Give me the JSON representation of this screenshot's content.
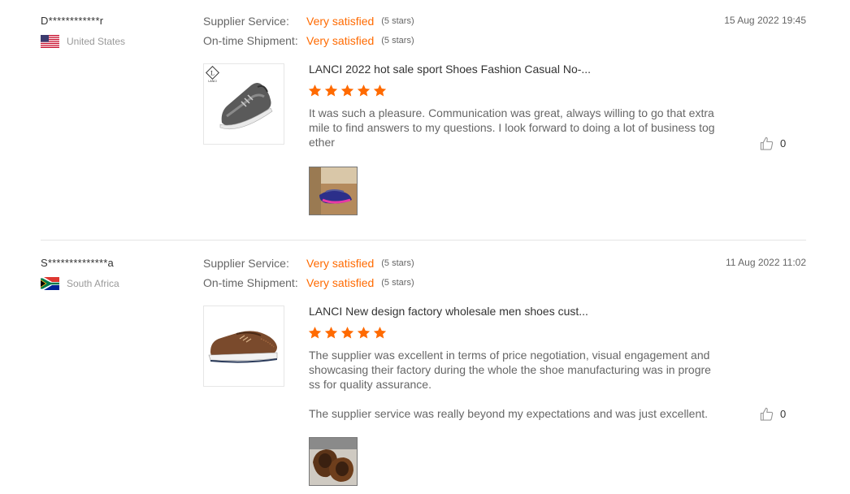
{
  "reviews": [
    {
      "user": {
        "name": "D************r",
        "country": "United States",
        "flag_icon": "us-flag-icon"
      },
      "ratings": [
        {
          "label": "Supplier Service:",
          "value": "Very satisfied",
          "stars_text": "(5 stars)"
        },
        {
          "label": "On-time Shipment:",
          "value": "Very satisfied",
          "stars_text": "(5 stars)"
        }
      ],
      "date": "15 Aug 2022 19:45",
      "product": {
        "title": "LANCI 2022 hot sale sport Shoes Fashion Casual No-...",
        "logo_text": "LANCI"
      },
      "star_rating": 5,
      "text": [
        "It was such a pleasure. Communication was great, always willing to go that extra mile to find answers to my questions. I look forward to doing a lot of business together"
      ],
      "likes": "0"
    },
    {
      "user": {
        "name": "S**************a",
        "country": "South Africa",
        "flag_icon": "za-flag-icon"
      },
      "ratings": [
        {
          "label": "Supplier Service:",
          "value": "Very satisfied",
          "stars_text": "(5 stars)"
        },
        {
          "label": "On-time Shipment:",
          "value": "Very satisfied",
          "stars_text": "(5 stars)"
        }
      ],
      "date": "11 Aug 2022 11:02",
      "product": {
        "title": "LANCI New design factory wholesale men shoes cust..."
      },
      "star_rating": 5,
      "text": [
        "The supplier was excellent in terms of price negotiation, visual engagement and showcasing their factory during the whole the shoe manufacturing was in progress for quality assurance.",
        "The supplier service was really beyond my expectations and was just excellent."
      ],
      "likes": "0"
    }
  ],
  "colors": {
    "accent": "#ff6a00",
    "muted": "#666666",
    "divider": "#e4e4e4"
  }
}
